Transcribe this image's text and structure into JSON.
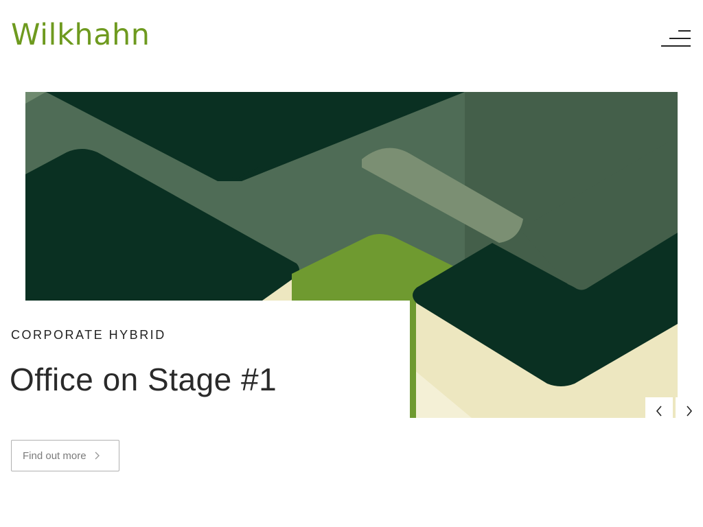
{
  "header": {
    "logo_text": "Wilkhahn",
    "menu_icon": "hamburger-menu-icon"
  },
  "hero": {
    "image_alt": "Abstract green geometric shapes artwork",
    "kicker": "CORPORATE HYBRID",
    "title": "Office on Stage #1",
    "cta_label": "Find out more",
    "cta_icon": "chevron-right-icon",
    "prev_icon": "chevron-left-icon",
    "next_icon": "chevron-right-icon"
  },
  "colors": {
    "brand_green": "#6e9a1f",
    "dark_green": "#0a3022",
    "mid_green": "#4f6c56",
    "bright_green": "#6f9a30",
    "cream": "#ede7c0"
  }
}
